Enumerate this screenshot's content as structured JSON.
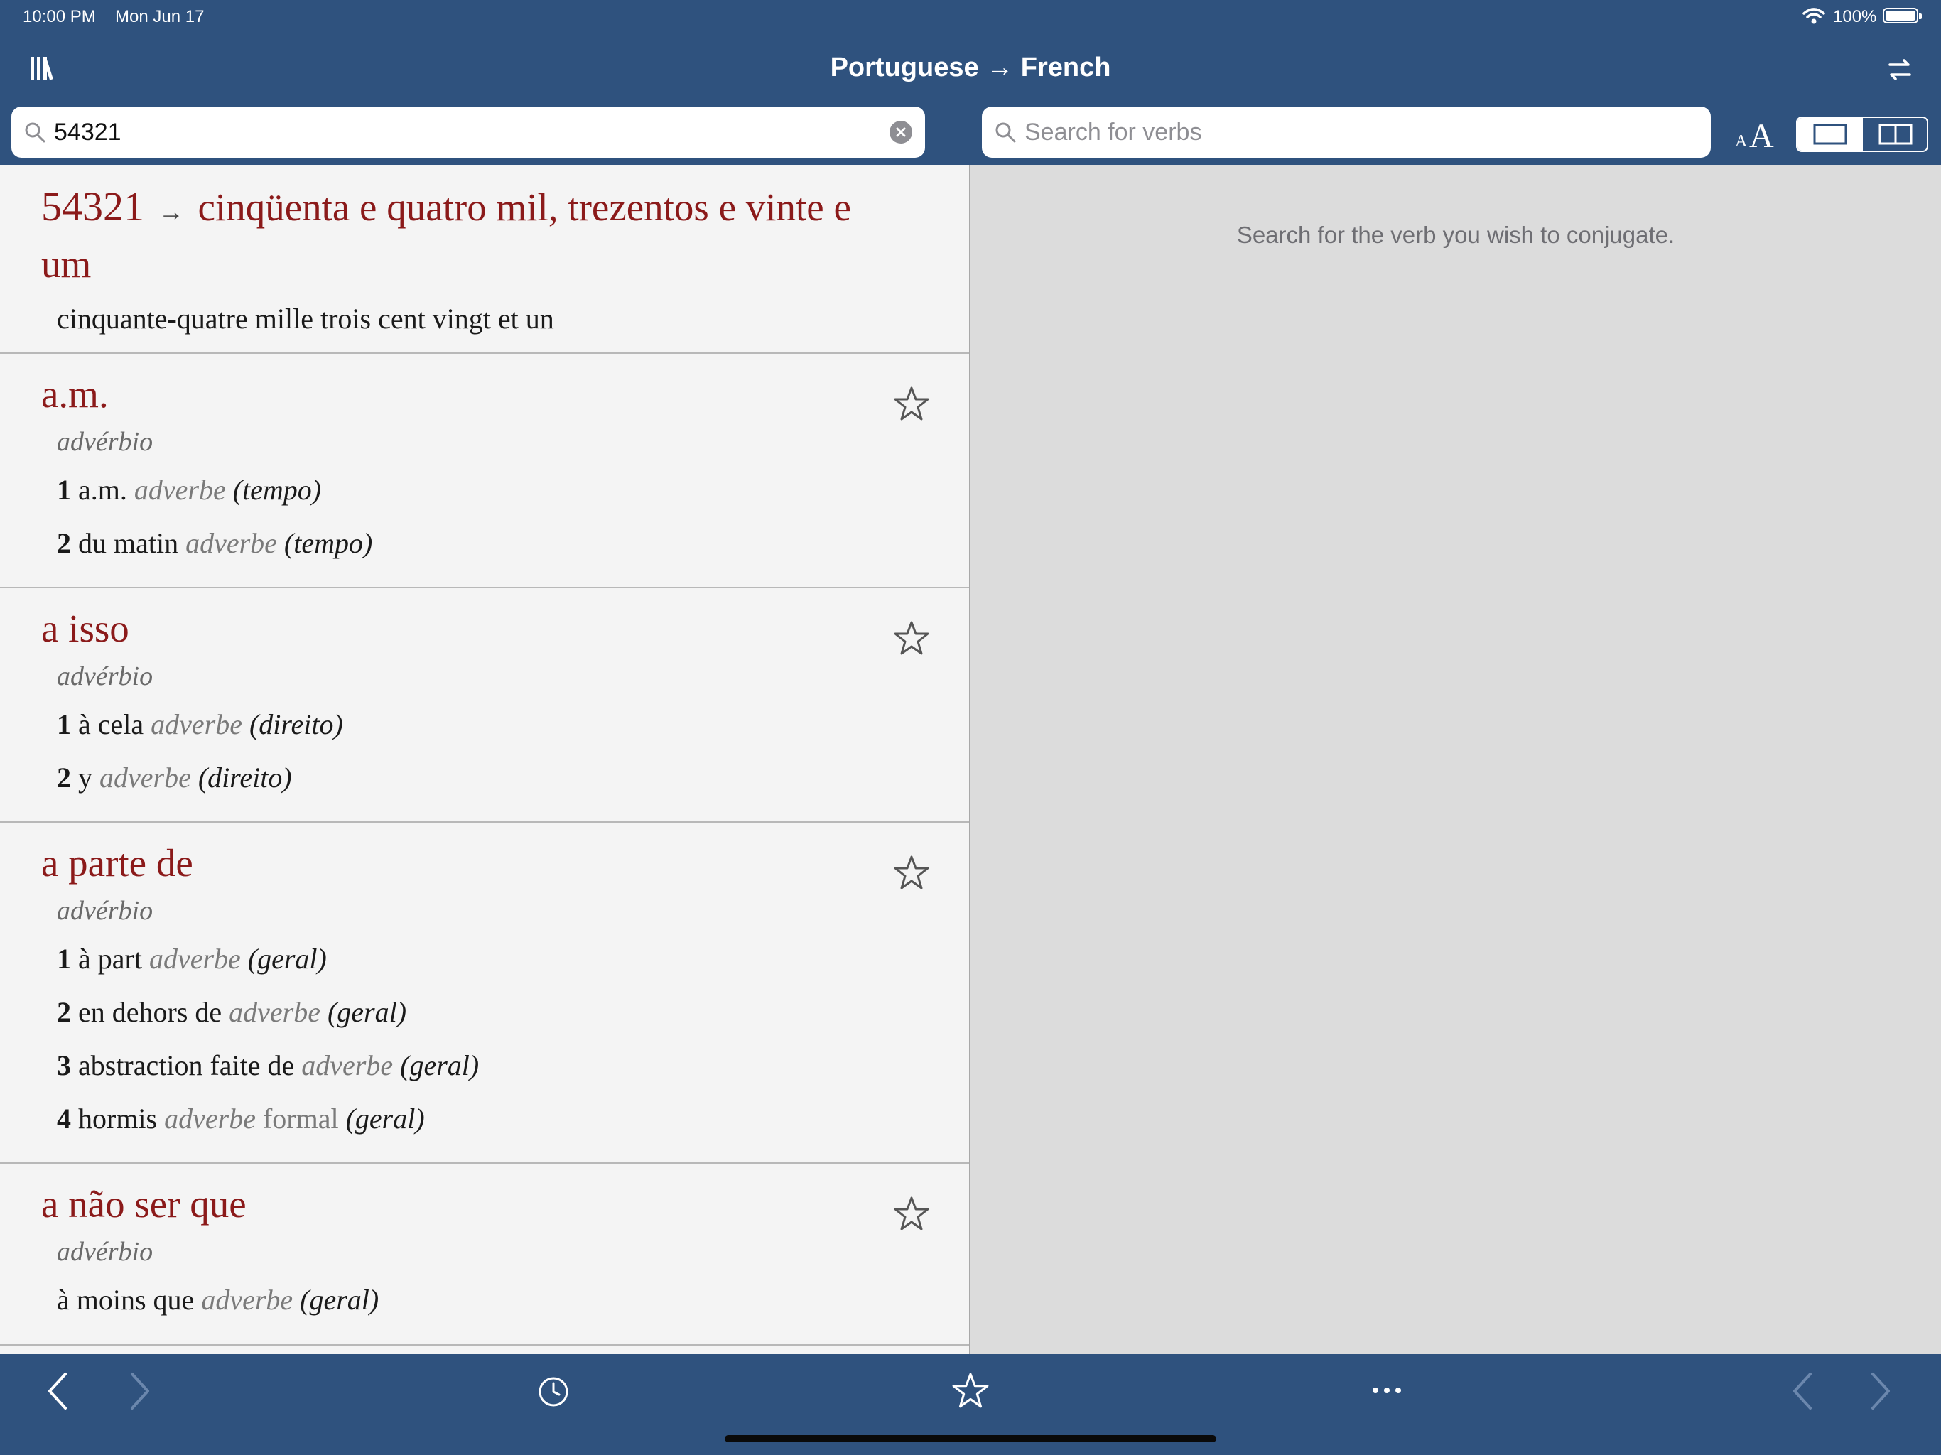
{
  "status_bar": {
    "time": "10:00 PM",
    "date": "Mon Jun 17",
    "battery": "100%"
  },
  "nav": {
    "title": "Portuguese → French"
  },
  "search": {
    "value": "54321",
    "verb_placeholder": "Search for verbs"
  },
  "font_size_labels": {
    "small": "A",
    "large": "A"
  },
  "conjugation": {
    "empty_message": "Search for the verb you wish to conjugate."
  },
  "entries": [
    {
      "number": "54321",
      "arrow": "→",
      "headword": "cinqüenta e quatro mil, trezentos e vinte e um",
      "translation": "cinquante-quatre mille trois cent vingt et un"
    },
    {
      "headword": "a.m.",
      "pos": "advérbio",
      "senses": [
        {
          "n": "1",
          "text": "a.m.",
          "gram": "adverbe",
          "domain": "(tempo)"
        },
        {
          "n": "2",
          "text": "du matin",
          "gram": "adverbe",
          "domain": "(tempo)"
        }
      ]
    },
    {
      "headword": "a isso",
      "pos": "advérbio",
      "senses": [
        {
          "n": "1",
          "text": "à cela",
          "gram": "adverbe",
          "domain": "(direito)"
        },
        {
          "n": "2",
          "text": "y",
          "gram": "adverbe",
          "domain": "(direito)"
        }
      ]
    },
    {
      "headword": "a parte de",
      "pos": "advérbio",
      "senses": [
        {
          "n": "1",
          "text": "à part",
          "gram": "adverbe",
          "domain": "(geral)"
        },
        {
          "n": "2",
          "text": "en dehors de",
          "gram": "adverbe",
          "domain": "(geral)"
        },
        {
          "n": "3",
          "text": "abstraction faite de",
          "gram": "adverbe",
          "domain": "(geral)"
        },
        {
          "n": "4",
          "text": "hormis",
          "gram": "adverbe",
          "register": "formal",
          "domain": "(geral)"
        }
      ]
    },
    {
      "headword": "a não ser que",
      "pos": "advérbio",
      "translation": "à moins que",
      "gram": "adverbe",
      "domain": "(geral)"
    }
  ],
  "icons": {
    "library": "library-icon",
    "swap": "swap-languages-icon",
    "search": "search-icon",
    "clear": "clear-icon",
    "star": "star-icon",
    "history": "history-icon",
    "more": "more-icon"
  },
  "colors": {
    "bar": "#2f527e",
    "headword": "#8b1a1a",
    "pane": "#f4f4f4",
    "conjugation_pane": "#dcdcdc"
  }
}
